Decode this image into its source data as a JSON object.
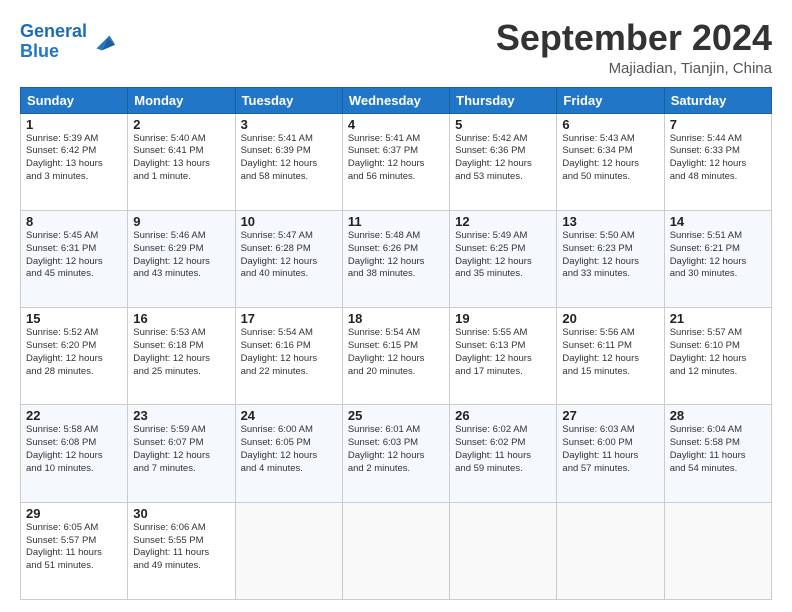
{
  "header": {
    "logo_general": "General",
    "logo_blue": "Blue",
    "month_title": "September 2024",
    "location": "Majiadian, Tianjin, China"
  },
  "weekdays": [
    "Sunday",
    "Monday",
    "Tuesday",
    "Wednesday",
    "Thursday",
    "Friday",
    "Saturday"
  ],
  "weeks": [
    [
      {
        "day": "1",
        "lines": [
          "Sunrise: 5:39 AM",
          "Sunset: 6:42 PM",
          "Daylight: 13 hours",
          "and 3 minutes."
        ]
      },
      {
        "day": "2",
        "lines": [
          "Sunrise: 5:40 AM",
          "Sunset: 6:41 PM",
          "Daylight: 13 hours",
          "and 1 minute."
        ]
      },
      {
        "day": "3",
        "lines": [
          "Sunrise: 5:41 AM",
          "Sunset: 6:39 PM",
          "Daylight: 12 hours",
          "and 58 minutes."
        ]
      },
      {
        "day": "4",
        "lines": [
          "Sunrise: 5:41 AM",
          "Sunset: 6:37 PM",
          "Daylight: 12 hours",
          "and 56 minutes."
        ]
      },
      {
        "day": "5",
        "lines": [
          "Sunrise: 5:42 AM",
          "Sunset: 6:36 PM",
          "Daylight: 12 hours",
          "and 53 minutes."
        ]
      },
      {
        "day": "6",
        "lines": [
          "Sunrise: 5:43 AM",
          "Sunset: 6:34 PM",
          "Daylight: 12 hours",
          "and 50 minutes."
        ]
      },
      {
        "day": "7",
        "lines": [
          "Sunrise: 5:44 AM",
          "Sunset: 6:33 PM",
          "Daylight: 12 hours",
          "and 48 minutes."
        ]
      }
    ],
    [
      {
        "day": "8",
        "lines": [
          "Sunrise: 5:45 AM",
          "Sunset: 6:31 PM",
          "Daylight: 12 hours",
          "and 45 minutes."
        ]
      },
      {
        "day": "9",
        "lines": [
          "Sunrise: 5:46 AM",
          "Sunset: 6:29 PM",
          "Daylight: 12 hours",
          "and 43 minutes."
        ]
      },
      {
        "day": "10",
        "lines": [
          "Sunrise: 5:47 AM",
          "Sunset: 6:28 PM",
          "Daylight: 12 hours",
          "and 40 minutes."
        ]
      },
      {
        "day": "11",
        "lines": [
          "Sunrise: 5:48 AM",
          "Sunset: 6:26 PM",
          "Daylight: 12 hours",
          "and 38 minutes."
        ]
      },
      {
        "day": "12",
        "lines": [
          "Sunrise: 5:49 AM",
          "Sunset: 6:25 PM",
          "Daylight: 12 hours",
          "and 35 minutes."
        ]
      },
      {
        "day": "13",
        "lines": [
          "Sunrise: 5:50 AM",
          "Sunset: 6:23 PM",
          "Daylight: 12 hours",
          "and 33 minutes."
        ]
      },
      {
        "day": "14",
        "lines": [
          "Sunrise: 5:51 AM",
          "Sunset: 6:21 PM",
          "Daylight: 12 hours",
          "and 30 minutes."
        ]
      }
    ],
    [
      {
        "day": "15",
        "lines": [
          "Sunrise: 5:52 AM",
          "Sunset: 6:20 PM",
          "Daylight: 12 hours",
          "and 28 minutes."
        ]
      },
      {
        "day": "16",
        "lines": [
          "Sunrise: 5:53 AM",
          "Sunset: 6:18 PM",
          "Daylight: 12 hours",
          "and 25 minutes."
        ]
      },
      {
        "day": "17",
        "lines": [
          "Sunrise: 5:54 AM",
          "Sunset: 6:16 PM",
          "Daylight: 12 hours",
          "and 22 minutes."
        ]
      },
      {
        "day": "18",
        "lines": [
          "Sunrise: 5:54 AM",
          "Sunset: 6:15 PM",
          "Daylight: 12 hours",
          "and 20 minutes."
        ]
      },
      {
        "day": "19",
        "lines": [
          "Sunrise: 5:55 AM",
          "Sunset: 6:13 PM",
          "Daylight: 12 hours",
          "and 17 minutes."
        ]
      },
      {
        "day": "20",
        "lines": [
          "Sunrise: 5:56 AM",
          "Sunset: 6:11 PM",
          "Daylight: 12 hours",
          "and 15 minutes."
        ]
      },
      {
        "day": "21",
        "lines": [
          "Sunrise: 5:57 AM",
          "Sunset: 6:10 PM",
          "Daylight: 12 hours",
          "and 12 minutes."
        ]
      }
    ],
    [
      {
        "day": "22",
        "lines": [
          "Sunrise: 5:58 AM",
          "Sunset: 6:08 PM",
          "Daylight: 12 hours",
          "and 10 minutes."
        ]
      },
      {
        "day": "23",
        "lines": [
          "Sunrise: 5:59 AM",
          "Sunset: 6:07 PM",
          "Daylight: 12 hours",
          "and 7 minutes."
        ]
      },
      {
        "day": "24",
        "lines": [
          "Sunrise: 6:00 AM",
          "Sunset: 6:05 PM",
          "Daylight: 12 hours",
          "and 4 minutes."
        ]
      },
      {
        "day": "25",
        "lines": [
          "Sunrise: 6:01 AM",
          "Sunset: 6:03 PM",
          "Daylight: 12 hours",
          "and 2 minutes."
        ]
      },
      {
        "day": "26",
        "lines": [
          "Sunrise: 6:02 AM",
          "Sunset: 6:02 PM",
          "Daylight: 11 hours",
          "and 59 minutes."
        ]
      },
      {
        "day": "27",
        "lines": [
          "Sunrise: 6:03 AM",
          "Sunset: 6:00 PM",
          "Daylight: 11 hours",
          "and 57 minutes."
        ]
      },
      {
        "day": "28",
        "lines": [
          "Sunrise: 6:04 AM",
          "Sunset: 5:58 PM",
          "Daylight: 11 hours",
          "and 54 minutes."
        ]
      }
    ],
    [
      {
        "day": "29",
        "lines": [
          "Sunrise: 6:05 AM",
          "Sunset: 5:57 PM",
          "Daylight: 11 hours",
          "and 51 minutes."
        ]
      },
      {
        "day": "30",
        "lines": [
          "Sunrise: 6:06 AM",
          "Sunset: 5:55 PM",
          "Daylight: 11 hours",
          "and 49 minutes."
        ]
      },
      {
        "day": "",
        "lines": []
      },
      {
        "day": "",
        "lines": []
      },
      {
        "day": "",
        "lines": []
      },
      {
        "day": "",
        "lines": []
      },
      {
        "day": "",
        "lines": []
      }
    ]
  ]
}
